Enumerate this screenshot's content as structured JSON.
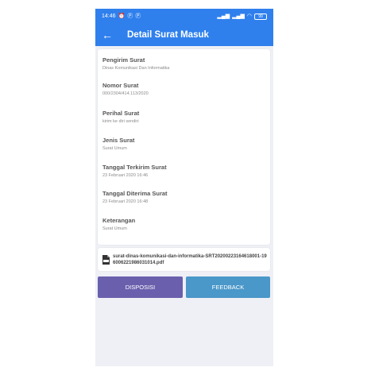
{
  "status_bar": {
    "time": "14:46",
    "left_icons": [
      "alarm-icon",
      "p-notification-icon",
      "p-notification-icon"
    ],
    "right_icons": [
      "signal-icon",
      "signal-icon",
      "wifi-icon"
    ],
    "battery": "99"
  },
  "app_bar": {
    "title": "Detail Surat Masuk"
  },
  "details": [
    {
      "label": "Pengirim Surat",
      "value": "Dinas Komunikasi Dan Informatika"
    },
    {
      "label": "Nomor Surat",
      "value": "000/2304/414.113/2020"
    },
    {
      "label": "Perihal Surat",
      "value": "kirim ke diri sendiri"
    },
    {
      "label": "Jenis Surat",
      "value": "Surat Umum"
    },
    {
      "label": "Tanggal Terkirim Surat",
      "value": "23 Februari 2020 16:46"
    },
    {
      "label": "Tanggal Diterima Surat",
      "value": "23 Februari 2020 16:48"
    },
    {
      "label": "Keterangan",
      "value": "Surat Umum"
    }
  ],
  "attachment": {
    "filename": "surat-dinas-komunikasi-dan-informatika-SRT20200223164618001-196006221986031014.pdf"
  },
  "buttons": {
    "disposisi": "DISPOSISI",
    "feedback": "FEEDBACK"
  },
  "colors": {
    "primary": "#2f80ed",
    "disposisi": "#6a5fad",
    "feedback": "#4a97c9",
    "background": "#eef0f5"
  }
}
